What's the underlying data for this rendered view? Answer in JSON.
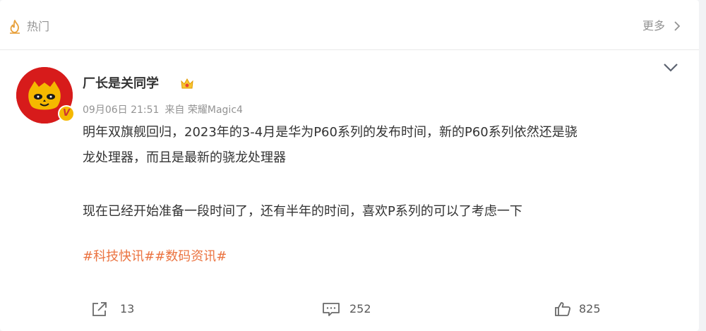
{
  "header": {
    "section_title": "热门",
    "more_label": "更多"
  },
  "post": {
    "author": "厂长是关同学",
    "verified_badge": "V",
    "timestamp": "09月06日 21:51",
    "source": "来自 荣耀Magic4",
    "paragraph1_line1": "明年双旗舰回归，2023年的3-4月是华为P60系列的发布时间，新的P60系列依然还是骁",
    "paragraph1_line2": "龙处理器，而且是最新的骁龙处理器",
    "paragraph2": "现在已经开始准备一段时间了，还有半年的时间，喜欢P系列的可以了考虑一下",
    "tags": "#科技快讯##数码资讯#"
  },
  "actions": {
    "share_count": "13",
    "comment_count": "252",
    "like_count": "825"
  },
  "colors": {
    "tag": "#eb7340",
    "avatar_bg": "#d71b1b",
    "badge": "#f5b800",
    "muted": "#939393"
  },
  "icons": [
    "flame-icon",
    "chevron-right-icon",
    "crown-icon",
    "chevron-down-icon",
    "share-icon",
    "comment-icon",
    "like-icon"
  ]
}
